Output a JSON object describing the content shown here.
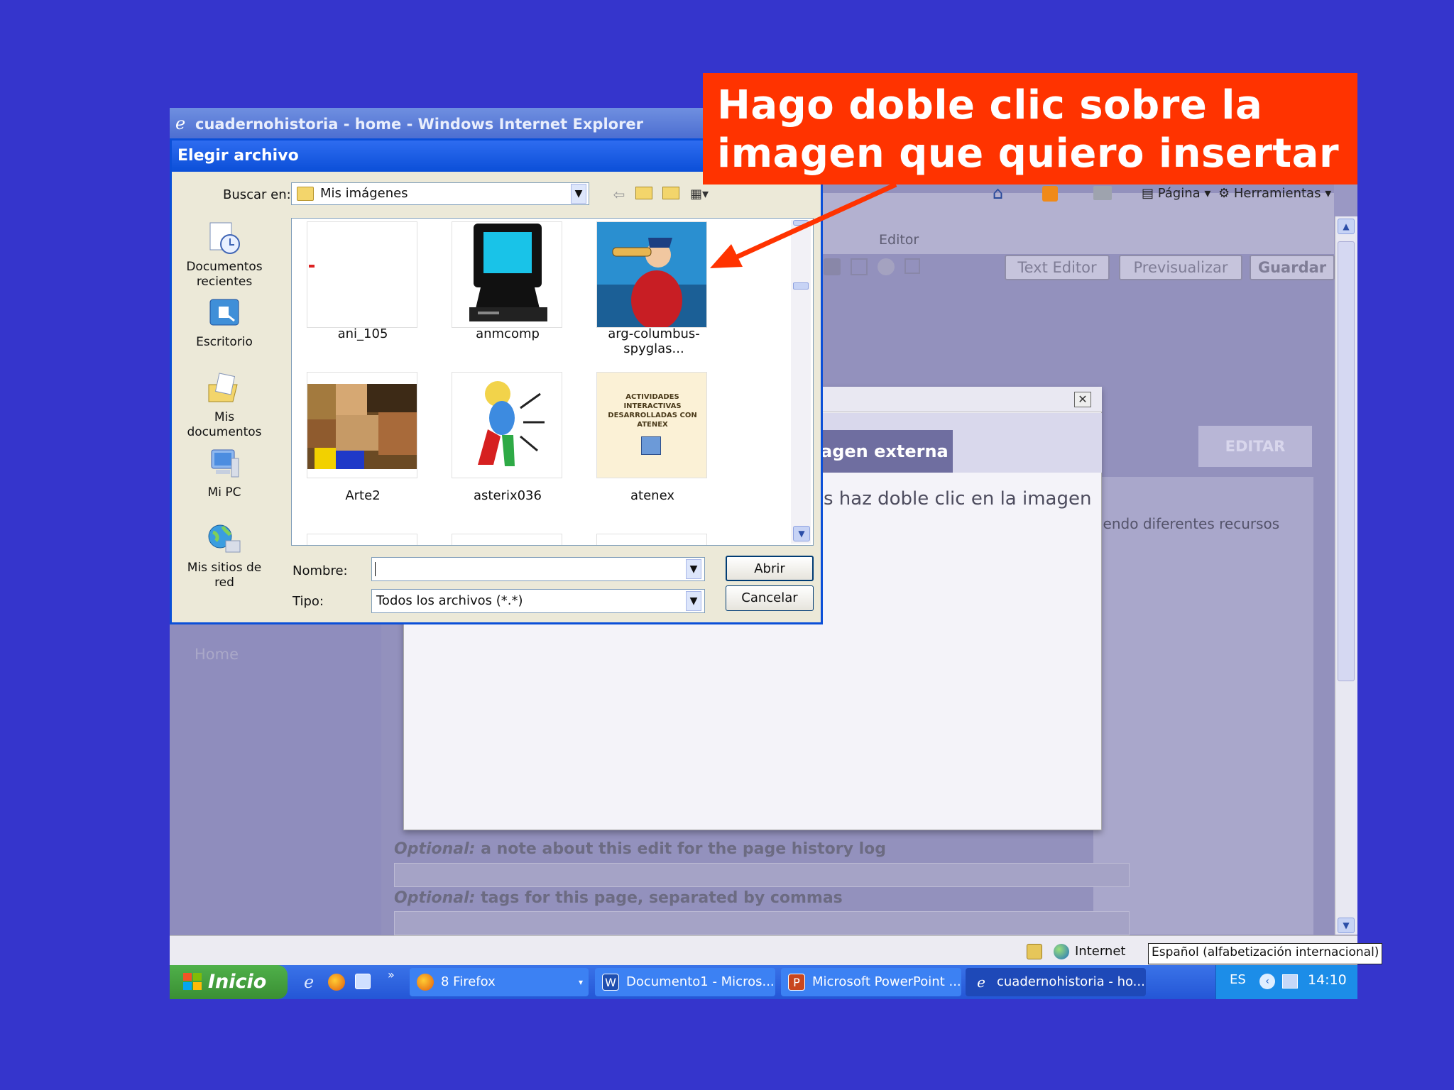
{
  "ie": {
    "title": "cuadernohistoria - home - Windows Internet Explorer",
    "command_bar": {
      "page_label": "Página",
      "tools_label": "Herramientas"
    },
    "editor_label": "Editor",
    "editor_buttons": [
      "Text Editor",
      "Previsualizar",
      "Guardar"
    ],
    "editar_tab": "EDITAR",
    "background_text_right": "iendo diferentes recursos",
    "home_link": "Home",
    "insert_panel": {
      "tab_label": "agen externa",
      "instruction": "s haz doble clic en la imagen",
      "close_glyph": "✕"
    },
    "optional_note": {
      "prefix": "Optional:",
      "text": " a note about this edit for the page history log"
    },
    "optional_tags": {
      "prefix": "Optional:",
      "text": " tags for this page, separated by commas"
    },
    "status": {
      "zone": "Internet",
      "language_tooltip": "Español (alfabetización internacional)"
    }
  },
  "dialog": {
    "title": "Elegir archivo",
    "lookin_label": "Buscar en:",
    "lookin_value": "Mis imágenes",
    "places": [
      {
        "label": "Documentos recientes",
        "icon": "recent-documents-icon"
      },
      {
        "label": "Escritorio",
        "icon": "desktop-icon"
      },
      {
        "label": "Mis documentos",
        "icon": "my-documents-icon"
      },
      {
        "label": "Mi PC",
        "icon": "my-computer-icon"
      },
      {
        "label": "Mis sitios de red",
        "icon": "network-places-icon"
      }
    ],
    "files": [
      "ani_105",
      "anmcomp",
      "arg-columbus-spyglas...",
      "Arte2",
      "asterix036",
      "atenex"
    ],
    "atenex_thumb_text": "ACTIVIDADES INTERACTIVAS DESARROLLADAS CON ATENEX",
    "name_label": "Nombre:",
    "name_value": "",
    "type_label": "Tipo:",
    "type_value": "Todos los archivos (*.*)",
    "open_button": "Abrir",
    "cancel_button": "Cancelar"
  },
  "callout": {
    "line1": "Hago doble clic sobre la",
    "line2": "imagen que quiero insertar",
    "color": "#ff3300"
  },
  "taskbar": {
    "start_label": "Inicio",
    "tasks": [
      {
        "label": "8 Firefox",
        "icon": "firefox-icon"
      },
      {
        "label": "Documento1 - Micros...",
        "icon": "word-icon"
      },
      {
        "label": "Microsoft PowerPoint ...",
        "icon": "powerpoint-icon"
      },
      {
        "label": "cuadernohistoria - ho...",
        "icon": "ie-icon",
        "active": true
      }
    ],
    "language": "ES",
    "clock": "14:10"
  },
  "colors": {
    "desktop": "#3535cc",
    "xp_blue": "#0b4fd8",
    "callout_red": "#ff3300"
  }
}
